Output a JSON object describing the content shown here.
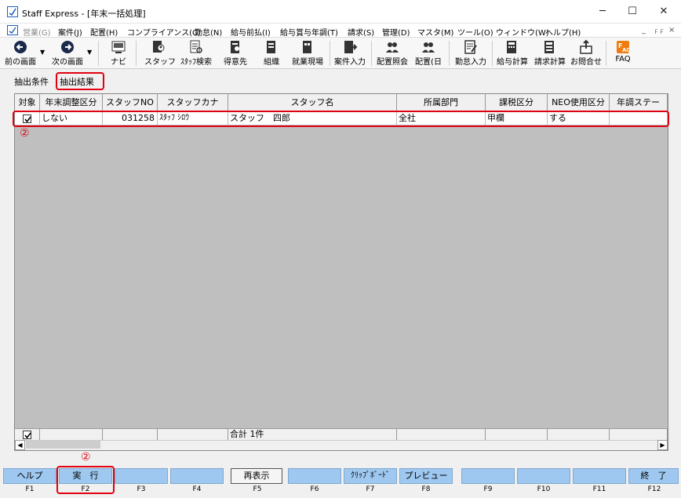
{
  "window": {
    "title": "Staff Express - [年末一括処理]",
    "minimize": "─",
    "maximize": "☐",
    "close": "✕"
  },
  "menu": [
    "営業(G)",
    "案件(J)",
    "配置(H)",
    "コンプライアンス(C)",
    "勤怠(N)",
    "給与前払(I)",
    "給与賞与年調(T)",
    "請求(S)",
    "管理(D)",
    "マスタ(M)",
    "ツール(O)",
    "ウィンドウ(W)",
    "ヘルプ(H)"
  ],
  "mdi": {
    "min": "_",
    "restore": "ＦＦ",
    "close": "×"
  },
  "toolbar": {
    "prev": "前の画面",
    "next": "次の画面",
    "navi": "ナビ",
    "staff": "スタッフ",
    "staff_search": "ｽﾀｯﾌ検索",
    "client": "得意先",
    "org": "組織",
    "site": "就業現場",
    "case_input": "案件入力",
    "assign_view": "配置照会",
    "assign_day": "配置(日",
    "attendance": "勤怠入力",
    "payroll": "給与計算",
    "billing": "請求計算",
    "inquiry": "お問合せ",
    "faq": "FAQ"
  },
  "tabs": {
    "conditions": "抽出条件",
    "results": "抽出結果"
  },
  "table": {
    "headers": [
      "対象",
      "年末調整区分",
      "スタッフNO",
      "スタッフカナ",
      "スタッフ名",
      "所属部門",
      "課税区分",
      "NEO使用区分",
      "年調ステー"
    ],
    "rows": [
      [
        "しない",
        "031258",
        "ｽﾀｯﾌ ｼﾛｳ",
        "スタッフ　四郎",
        "全社",
        "甲欄",
        "する",
        ""
      ]
    ],
    "footer_total": "合計 1件"
  },
  "markers": {
    "row": "②",
    "f2": "②"
  },
  "fkeys": [
    {
      "label": "ヘルプ",
      "key": "F1"
    },
    {
      "label": "実　行",
      "key": "F2"
    },
    {
      "label": "",
      "key": "F3"
    },
    {
      "label": "",
      "key": "F4"
    },
    {
      "label": "再表示",
      "key": "F5"
    },
    {
      "label": "",
      "key": "F6"
    },
    {
      "label": "ｸﾘｯﾌﾟﾎﾞｰﾄﾞ",
      "key": "F7"
    },
    {
      "label": "プレビュー",
      "key": "F8"
    },
    {
      "label": "",
      "key": "F9"
    },
    {
      "label": "",
      "key": "F10"
    },
    {
      "label": "",
      "key": "F11"
    },
    {
      "label": "終　了",
      "key": "F12"
    }
  ],
  "colors": {
    "fkey": "#9ec8ef",
    "highlight": "#e00010"
  }
}
